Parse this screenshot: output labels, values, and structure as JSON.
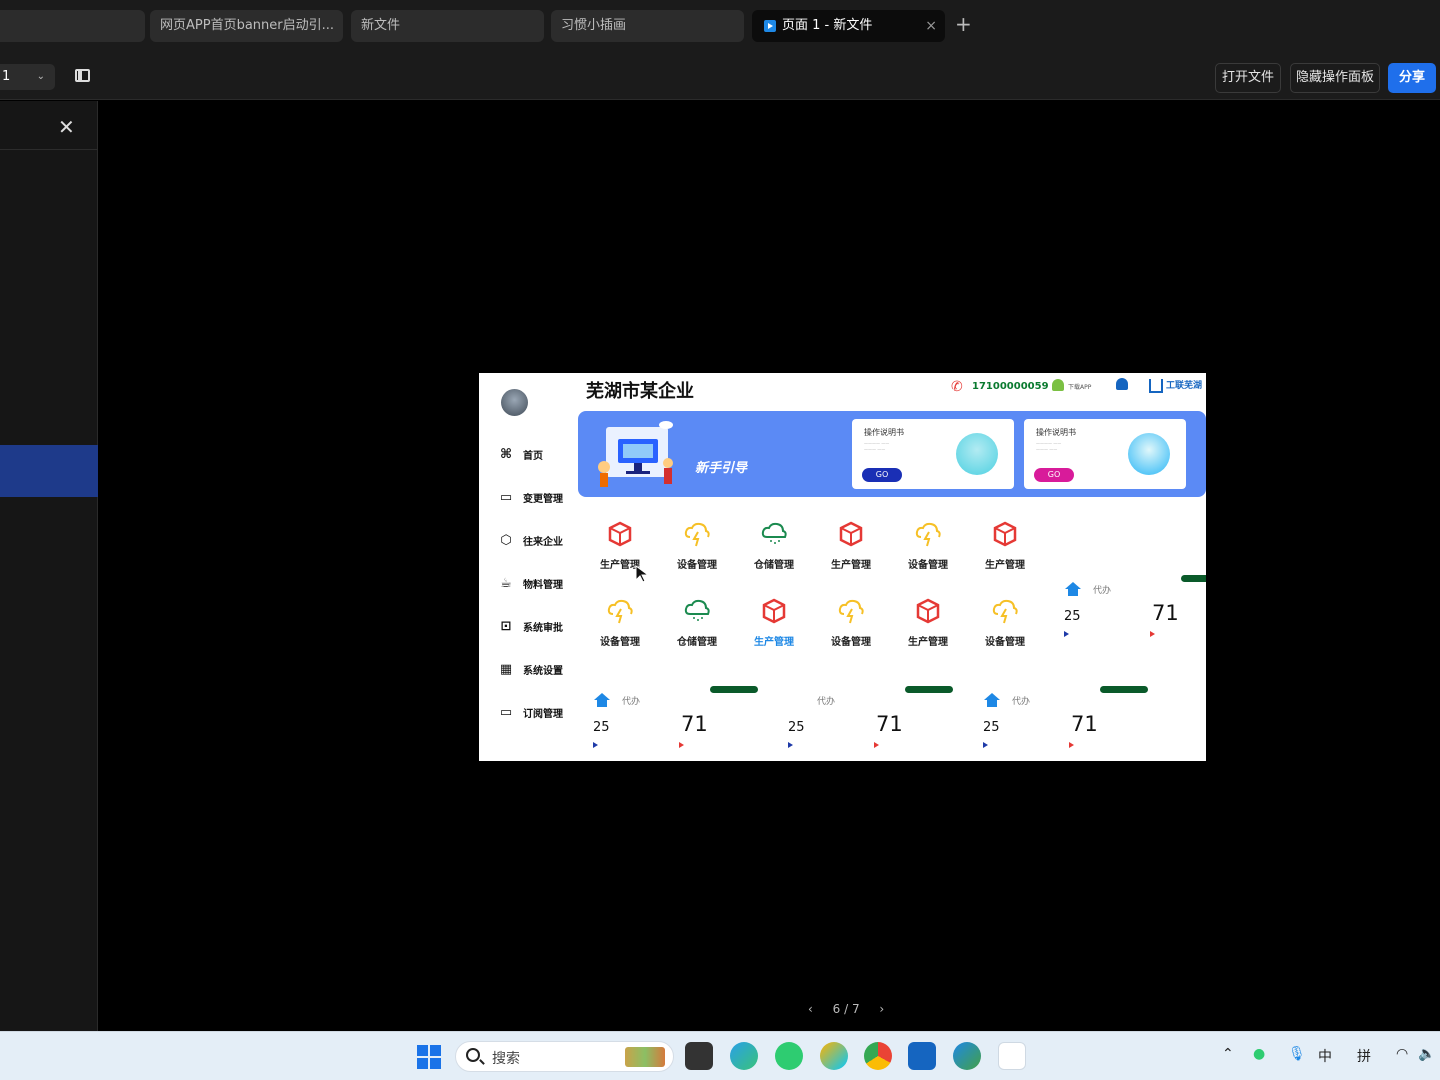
{
  "tabs": [
    {
      "label": ""
    },
    {
      "label": "网页APP首页banner启动引..."
    },
    {
      "label": "新文件"
    },
    {
      "label": "习惯小插画"
    },
    {
      "label": "页面 1 - 新文件"
    }
  ],
  "toolbar": {
    "page_select_value": "1",
    "open_file": "打开文件",
    "hide_panel": "隐藏操作面板",
    "share": "分享"
  },
  "pager": {
    "prev": "‹",
    "current": "6 / 7",
    "next": "›"
  },
  "slide": {
    "title": "芜湖市某企业",
    "phone": "17100000059",
    "download_app": "下载APP",
    "logo_text": "工联芜湖",
    "nav": [
      {
        "label": "首页",
        "icon": "command-icon"
      },
      {
        "label": "变更管理",
        "icon": "monitor-icon"
      },
      {
        "label": "往来企业",
        "icon": "cube-icon"
      },
      {
        "label": "物料管理",
        "icon": "cup-icon"
      },
      {
        "label": "系统审批",
        "icon": "chip-icon"
      },
      {
        "label": "系统设置",
        "icon": "film-icon"
      },
      {
        "label": "订阅管理",
        "icon": "card-icon"
      }
    ],
    "banner": {
      "guide_text": "新手引导",
      "cards": [
        {
          "title": "操作说明书",
          "go": "GO",
          "go_color": "#1a2fb5"
        },
        {
          "title": "操作说明书",
          "go": "GO",
          "go_color": "#d81b9a"
        }
      ]
    },
    "grid_row1": [
      "生产管理",
      "设备管理",
      "仓储管理",
      "生产管理",
      "设备管理",
      "生产管理"
    ],
    "grid_row2": [
      "设备管理",
      "仓储管理",
      "生产管理",
      "设备管理",
      "生产管理",
      "设备管理"
    ],
    "stats": [
      {
        "label": "代办",
        "a": "25",
        "b": "71"
      },
      {
        "label": "代办",
        "a": "25",
        "b": "71"
      },
      {
        "label": "代办",
        "a": "25",
        "b": "71"
      },
      {
        "label": "代办",
        "a": "25",
        "b": "71"
      }
    ],
    "colors": {
      "banner": "#5b8af5",
      "red_icon": "#e53935",
      "yellow_icon": "#f6c026",
      "green_icon": "#1b8a4f",
      "accent_blue": "#1e88e5"
    }
  },
  "taskbar": {
    "search_placeholder": "搜索",
    "ime_lang": "中",
    "ime_mode": "拼"
  }
}
